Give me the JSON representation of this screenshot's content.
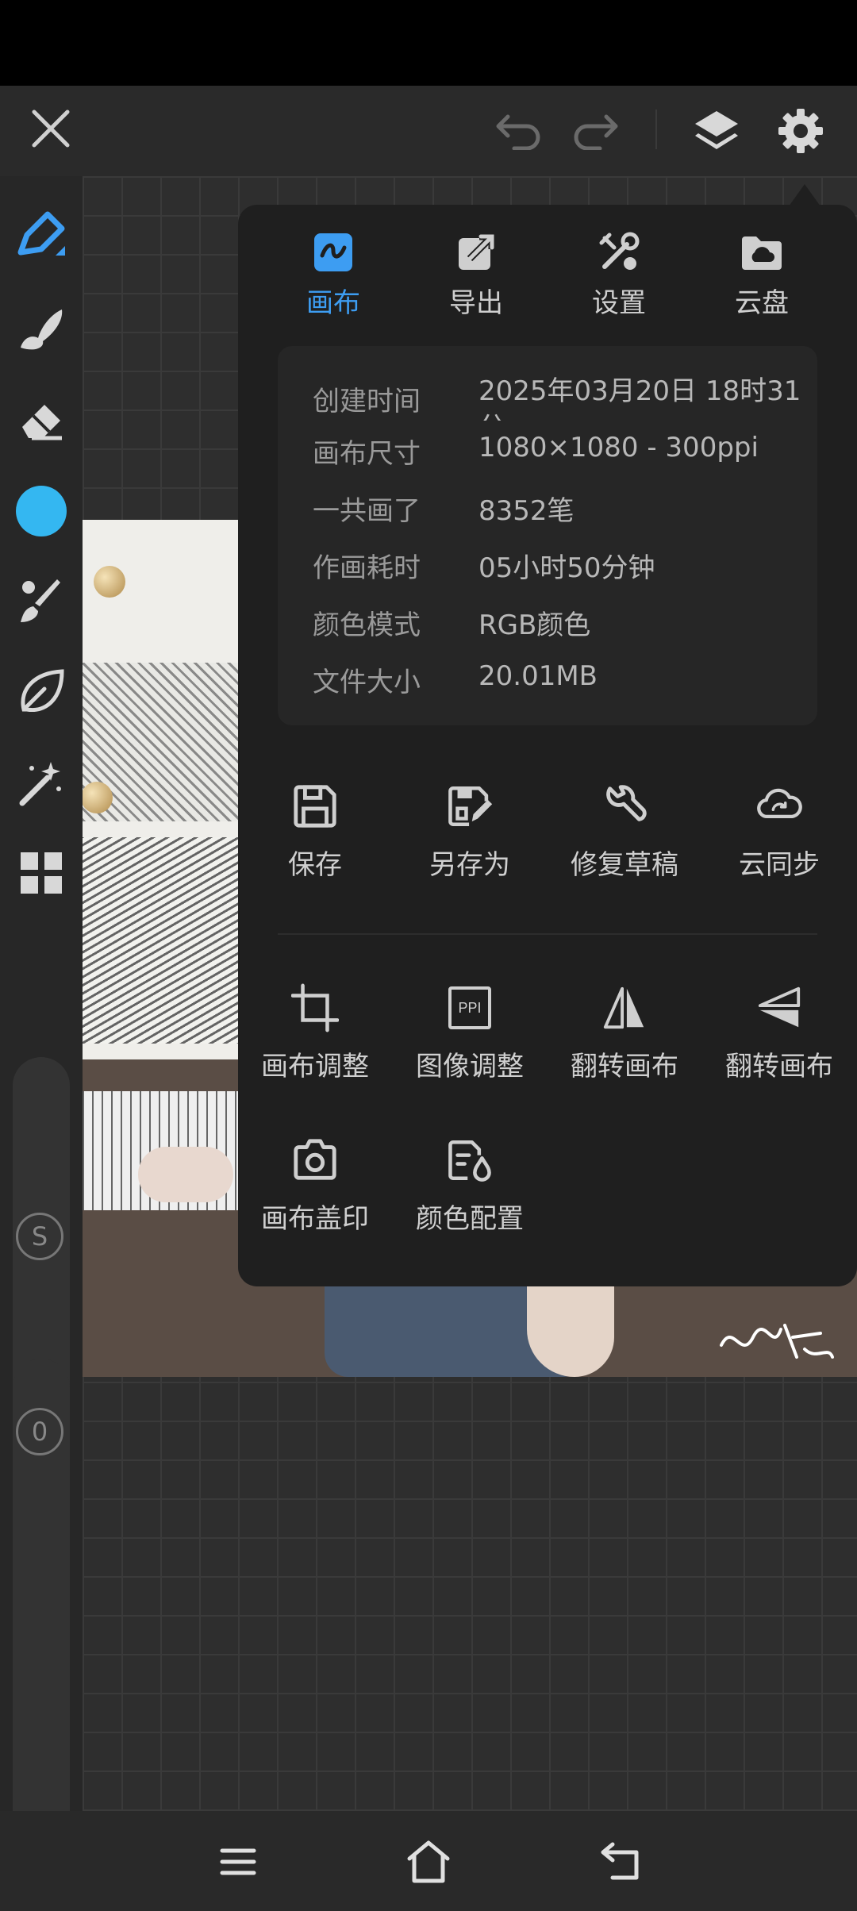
{
  "colors": {
    "accent": "#3d9df2",
    "color_swatch": "#34b7f1",
    "panel_bg": "#1f1f1f",
    "app_bg": "#2b2b2b"
  },
  "top_bar": {
    "close_icon": "close-icon",
    "undo_icon": "undo-icon",
    "redo_icon": "redo-icon",
    "layers_icon": "layers-icon",
    "settings_icon": "gear-icon"
  },
  "left_toolbar": {
    "tools": [
      "pencil-icon",
      "brush-icon",
      "eraser-icon",
      "color-swatch",
      "paint-brush-icon",
      "leaf-icon",
      "magic-wand-icon",
      "grid-icon"
    ],
    "size_slider_badge": "S",
    "opacity_slider_badge": "0"
  },
  "panel": {
    "tabs": [
      {
        "label": "画布",
        "icon": "canvas-icon",
        "active": true
      },
      {
        "label": "导出",
        "icon": "export-icon",
        "active": false
      },
      {
        "label": "设置",
        "icon": "tools-icon",
        "active": false
      },
      {
        "label": "云盘",
        "icon": "cloud-folder-icon",
        "active": false
      }
    ],
    "info": [
      {
        "label": "创建时间",
        "value": "2025年03月20日 18时31分"
      },
      {
        "label": "画布尺寸",
        "value": "1080×1080 - 300ppi"
      },
      {
        "label": "一共画了",
        "value": "8352笔"
      },
      {
        "label": "作画耗时",
        "value": "05小时50分钟"
      },
      {
        "label": "颜色模式",
        "value": "RGB颜色"
      },
      {
        "label": "文件大小",
        "value": "20.01MB"
      }
    ],
    "file_actions": [
      {
        "label": "保存",
        "icon": "save-icon"
      },
      {
        "label": "另存为",
        "icon": "save-as-icon"
      },
      {
        "label": "修复草稿",
        "icon": "wrench-icon"
      },
      {
        "label": "云同步",
        "icon": "cloud-sync-icon"
      }
    ],
    "canvas_actions": [
      {
        "label": "画布调整",
        "icon": "crop-icon"
      },
      {
        "label": "图像调整",
        "icon": "ppi-icon",
        "icon_text": "PPI"
      },
      {
        "label": "翻转画布",
        "icon": "flip-horizontal-icon"
      },
      {
        "label": "翻转画布",
        "icon": "flip-vertical-icon"
      },
      {
        "label": "画布盖印",
        "icon": "camera-icon"
      },
      {
        "label": "颜色配置",
        "icon": "color-profile-icon"
      }
    ]
  },
  "nav_bar": {
    "menu_icon": "menu-icon",
    "home_icon": "home-icon",
    "back_icon": "back-icon"
  }
}
